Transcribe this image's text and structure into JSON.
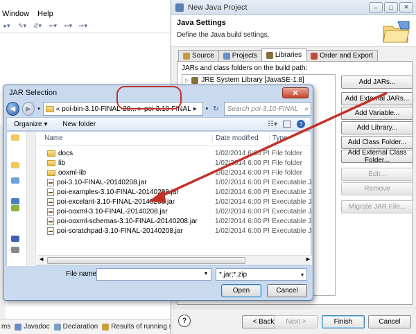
{
  "main_window": {
    "menu": [
      "Window",
      "Help"
    ],
    "bottom_tabs": [
      "ms",
      "Javadoc",
      "Declaration",
      "Results of running suite"
    ]
  },
  "new_java_project": {
    "window_title": "New Java Project",
    "header_title": "Java Settings",
    "header_desc": "Define the Java build settings.",
    "tabs": [
      "Source",
      "Projects",
      "Libraries",
      "Order and Export"
    ],
    "active_tab": "Libraries",
    "jar_label": "JARs and class folders on the build path:",
    "tree_item": "JRE System Library [JavaSE-1.8]",
    "buttons": {
      "add_jars": "Add JARs...",
      "add_external_jars": "Add External JARs...",
      "add_variable": "Add Variable...",
      "add_library": "Add Library...",
      "add_class_folder": "Add Class Folder...",
      "add_external_class_folder": "Add External Class Folder...",
      "edit": "Edit...",
      "remove": "Remove",
      "migrate_jar": "Migrate JAR File..."
    },
    "nav": {
      "back": "< Back",
      "next": "Next >",
      "finish": "Finish",
      "cancel": "Cancel"
    }
  },
  "jar_selection": {
    "title": "JAR Selection",
    "breadcrumbs": [
      "«",
      "poi-bin-3.10-FINAL-20...",
      "poi-3.10-FINAL"
    ],
    "search_placeholder": "Search poi-3.10-FINAL",
    "organize": "Organize ▾",
    "new_folder": "New folder",
    "columns": {
      "name": "Name",
      "date": "Date modified",
      "type": "Type"
    },
    "files": [
      {
        "name": "docs",
        "date": "1/02/2014 6:00 PM",
        "type": "File folder",
        "kind": "folder"
      },
      {
        "name": "lib",
        "date": "1/02/2014 6:00 PM",
        "type": "File folder",
        "kind": "folder"
      },
      {
        "name": "ooxml-lib",
        "date": "1/02/2014 6:00 PM",
        "type": "File folder",
        "kind": "folder"
      },
      {
        "name": "poi-3.10-FINAL-20140208.jar",
        "date": "1/02/2014 6:00 PM",
        "type": "Executable Jar File",
        "kind": "jar"
      },
      {
        "name": "poi-examples-3.10-FINAL-20140208.jar",
        "date": "1/02/2014 6:00 PM",
        "type": "Executable Jar File",
        "kind": "jar"
      },
      {
        "name": "poi-excelant-3.10-FINAL-20140208.jar",
        "date": "1/02/2014 6:00 PM",
        "type": "Executable Jar File",
        "kind": "jar"
      },
      {
        "name": "poi-ooxml-3.10-FINAL-20140208.jar",
        "date": "1/02/2014 6:00 PM",
        "type": "Executable Jar File",
        "kind": "jar"
      },
      {
        "name": "poi-ooxml-schemas-3.10-FINAL-20140208.jar",
        "date": "1/02/2014 6:00 PM",
        "type": "Executable Jar File",
        "kind": "jar"
      },
      {
        "name": "poi-scratchpad-3.10-FINAL-20140208.jar",
        "date": "1/02/2014 6:00 PM",
        "type": "Executable Jar File",
        "kind": "jar"
      }
    ],
    "file_name_label": "File name:",
    "file_name_value": "",
    "filter_value": "*.jar;*.zip",
    "open": "Open",
    "cancel": "Cancel"
  },
  "colors": {
    "annotation": "#c0322a",
    "accent": "#3c7fb1"
  }
}
